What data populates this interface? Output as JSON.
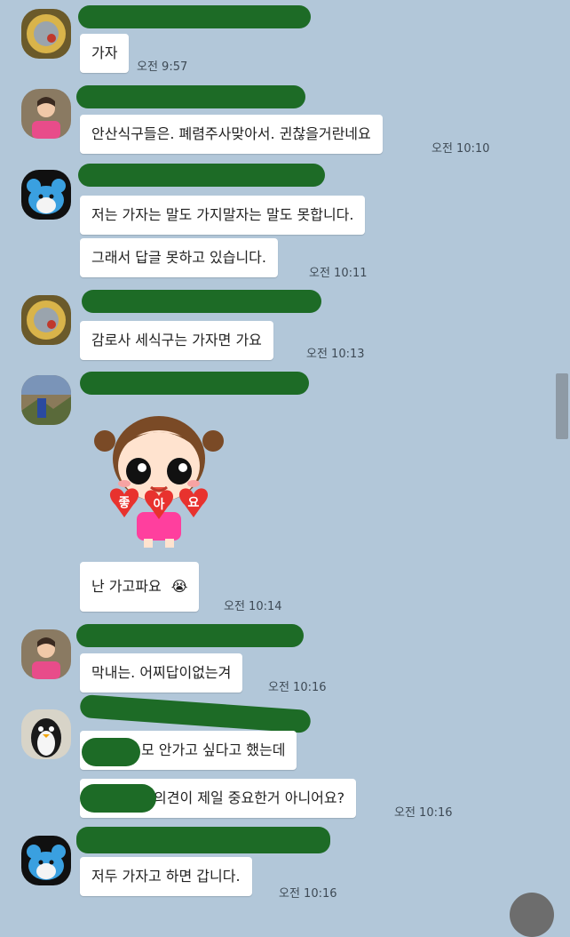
{
  "messages": [
    {
      "text": "가자",
      "time": "오전 9:57"
    },
    {
      "text": "안산식구들은. 폐렴주사맞아서. 귄찮을거란네요",
      "time": "오전 10:10"
    },
    {
      "text": "저는 가자는 말도 가지말자는 말도 못합니다."
    },
    {
      "text": "그래서 답글 못하고 있습니다.",
      "time": "오전 10:11"
    },
    {
      "text": "감로사 세식구는 가자면 가요",
      "time": "오전 10:13"
    },
    {
      "sticker_text": [
        "좋",
        "아",
        "요"
      ]
    },
    {
      "text": "난 가고파요",
      "emoji": "😭",
      "time": "오전 10:14"
    },
    {
      "text": "막내는. 어찌답이없는겨",
      "time": "오전 10:16"
    },
    {
      "text": "모 안가고 싶다고 했는데"
    },
    {
      "text": "의견이 제일 중요한거 아니어요?",
      "time": "오전 10:16"
    },
    {
      "text": "저두 가자고 하면 갑니다.",
      "time": "오전 10:16"
    }
  ]
}
